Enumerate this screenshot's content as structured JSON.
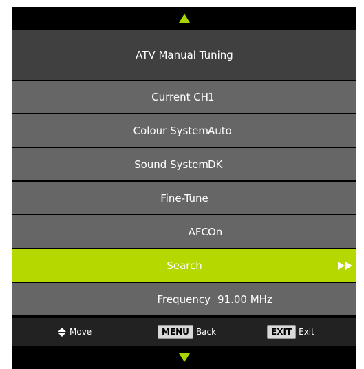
{
  "title": "ATV Manual Tuning",
  "menu": {
    "current_ch": {
      "label": "Current CH",
      "value": "1"
    },
    "colour_system": {
      "label": "Colour System",
      "value": "Auto"
    },
    "sound_system": {
      "label": "Sound System",
      "value": "DK"
    },
    "fine_tune": {
      "label": "Fine-Tune"
    },
    "afc": {
      "label": "AFC",
      "value": "On"
    },
    "search": {
      "label": "Search"
    },
    "frequency": {
      "label": "Frequency",
      "value": "91.00 MHz"
    }
  },
  "help": {
    "move": "Move",
    "menu_key": "MENU",
    "back": "Back",
    "exit_key": "EXIT",
    "exit": "Exit"
  },
  "colors": {
    "accent": "#b5d800",
    "row": "#666666",
    "title_bar": "#404040",
    "background": "#000000"
  },
  "icons": [
    "arrow-up-icon",
    "arrow-down-icon",
    "play-icon",
    "up-down-icon"
  ]
}
